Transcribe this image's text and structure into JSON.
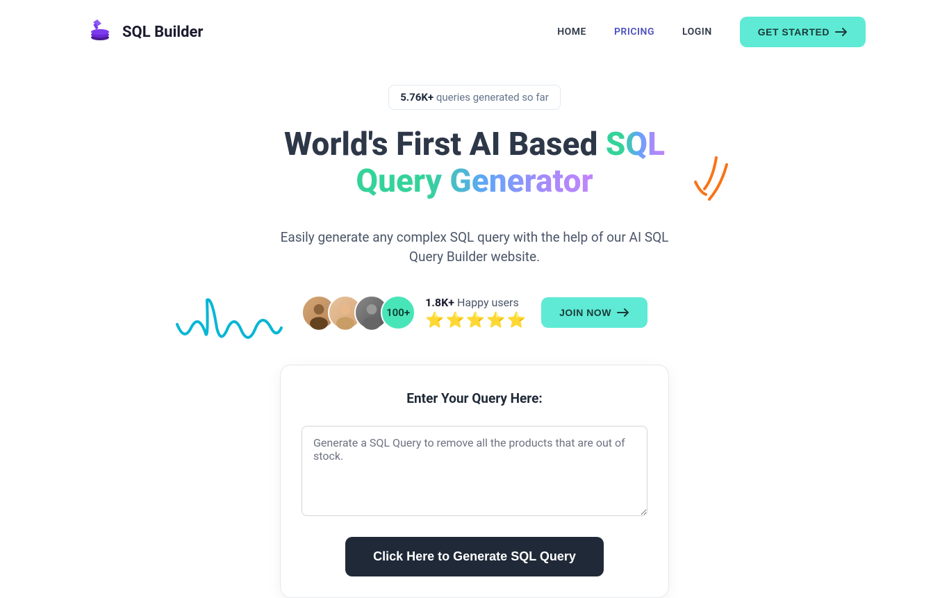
{
  "header": {
    "logo_text": "SQL Builder",
    "nav": {
      "home": "HOME",
      "pricing": "PRICING",
      "login": "LOGIN",
      "get_started": "GET STARTED"
    }
  },
  "hero": {
    "badge_count": "5.76K+",
    "badge_text": " queries generated so far",
    "title_line1": "World's First AI Based ",
    "title_highlight1": "SQL",
    "title_highlight2": "Query Generator",
    "subtitle": "Easily generate any complex SQL query with the help of our AI SQL Query Builder website."
  },
  "social": {
    "avatar_count": "100+",
    "user_count": "1.8K+",
    "user_text": " Happy users",
    "join_label": "JOIN NOW"
  },
  "query": {
    "label": "Enter Your Query Here:",
    "placeholder": "Generate a SQL Query to remove all the products that are out of stock.",
    "generate_label": "Click Here to Generate SQL Query"
  }
}
